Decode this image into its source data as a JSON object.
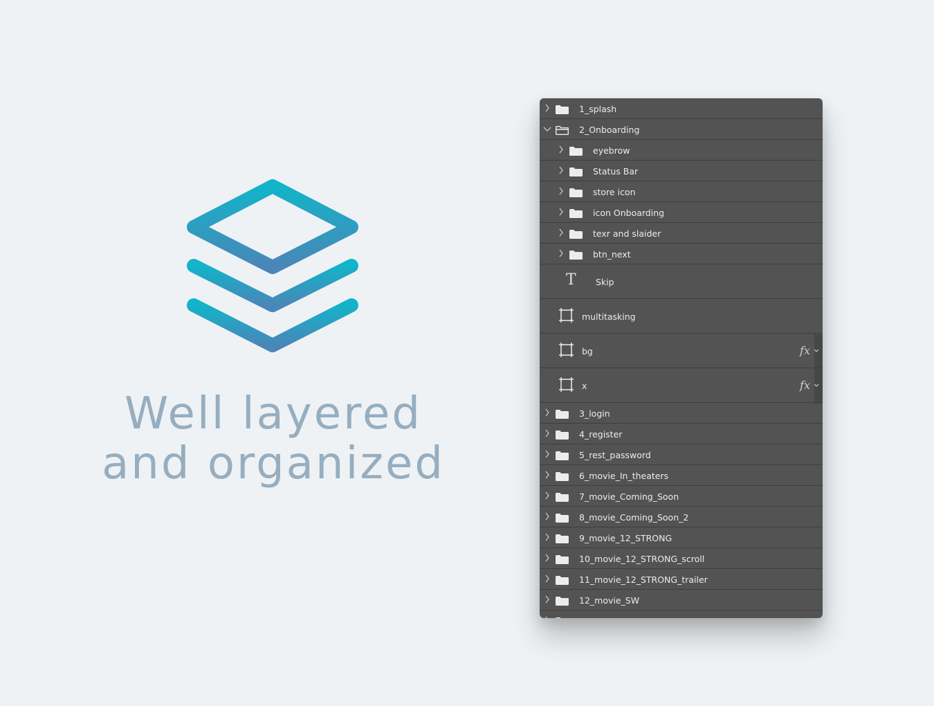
{
  "headline": {
    "line1": "Well layered",
    "line2": "and organized"
  },
  "logo": {
    "icon": "stacked-layers-icon",
    "gradient_top": "#12b4c9",
    "gradient_bottom": "#4a86b8"
  },
  "layers_panel": {
    "background": "#535353",
    "rows": [
      {
        "label": "1_splash",
        "kind": "group",
        "expanded": false,
        "depth": 0
      },
      {
        "label": "2_Onboarding",
        "kind": "group",
        "expanded": true,
        "depth": 0
      },
      {
        "label": "eyebrow",
        "kind": "group",
        "expanded": false,
        "depth": 1
      },
      {
        "label": "Status Bar",
        "kind": "group",
        "expanded": false,
        "depth": 1
      },
      {
        "label": "store icon",
        "kind": "group",
        "expanded": false,
        "depth": 1
      },
      {
        "label": "icon Onboarding",
        "kind": "group",
        "expanded": false,
        "depth": 1
      },
      {
        "label": "texr and slaider",
        "kind": "group",
        "expanded": false,
        "depth": 1
      },
      {
        "label": "btn_next",
        "kind": "group",
        "expanded": false,
        "depth": 1
      },
      {
        "label": "Skip",
        "kind": "text",
        "depth": 1
      },
      {
        "label": "multitasking",
        "kind": "shape",
        "depth": 1,
        "fx": false
      },
      {
        "label": "bg",
        "kind": "shape",
        "depth": 1,
        "fx": true,
        "fx_label": "fx"
      },
      {
        "label": "x",
        "kind": "shape",
        "depth": 1,
        "fx": true,
        "fx_label": "fx"
      },
      {
        "label": "3_login",
        "kind": "group",
        "expanded": false,
        "depth": 0
      },
      {
        "label": "4_register",
        "kind": "group",
        "expanded": false,
        "depth": 0
      },
      {
        "label": "5_rest_password",
        "kind": "group",
        "expanded": false,
        "depth": 0
      },
      {
        "label": "6_movie_In_theaters",
        "kind": "group",
        "expanded": false,
        "depth": 0
      },
      {
        "label": "7_movie_Coming_Soon",
        "kind": "group",
        "expanded": false,
        "depth": 0
      },
      {
        "label": "8_movie_Coming_Soon_2",
        "kind": "group",
        "expanded": false,
        "depth": 0
      },
      {
        "label": "9_movie_12_STRONG",
        "kind": "group",
        "expanded": false,
        "depth": 0
      },
      {
        "label": "10_movie_12_STRONG_scroll",
        "kind": "group",
        "expanded": false,
        "depth": 0
      },
      {
        "label": "11_movie_12_STRONG_trailer",
        "kind": "group",
        "expanded": false,
        "depth": 0
      },
      {
        "label": "12_movie_SW",
        "kind": "group",
        "expanded": false,
        "depth": 0
      },
      {
        "label": "",
        "kind": "group",
        "expanded": false,
        "depth": 0
      }
    ]
  }
}
